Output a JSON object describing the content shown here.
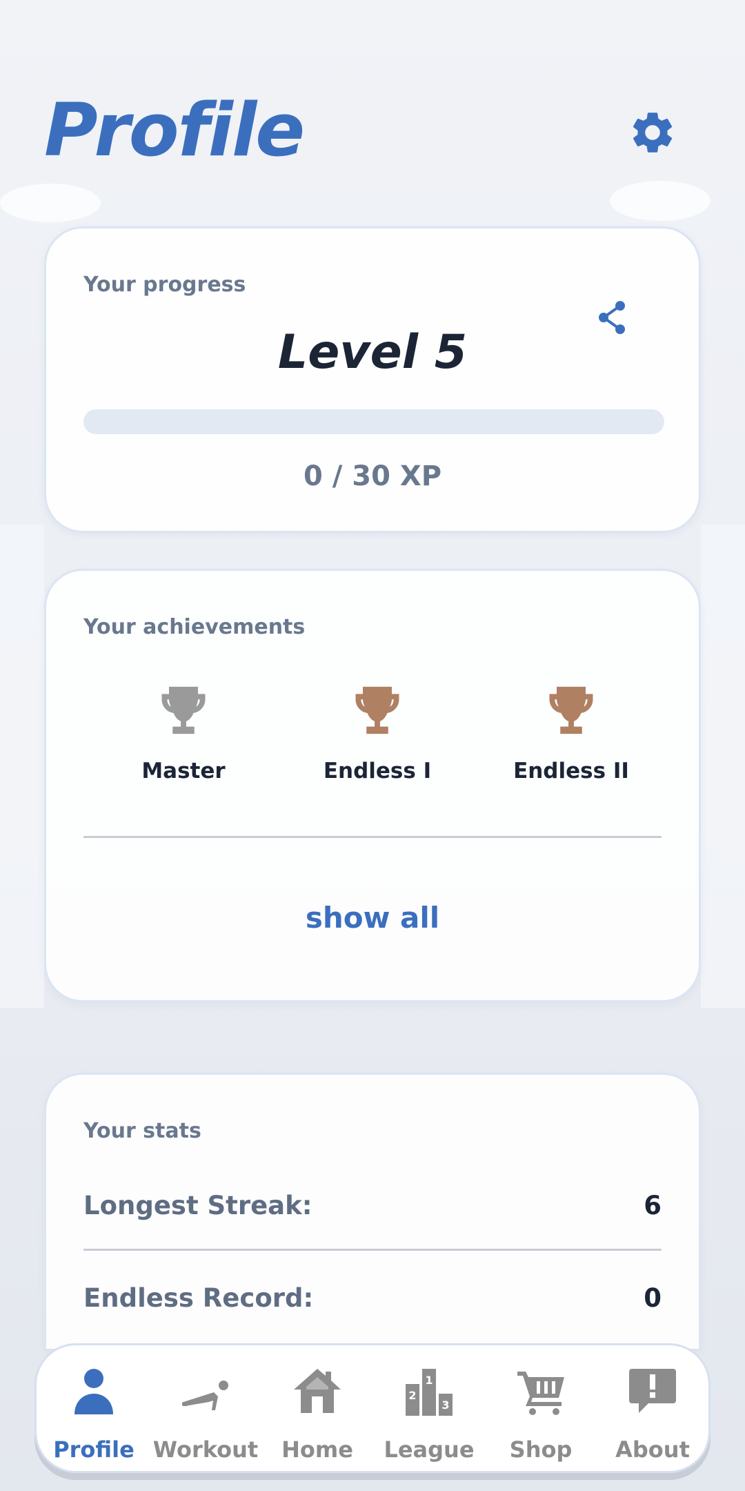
{
  "header": {
    "title": "Profile",
    "settings_icon": "gear-icon"
  },
  "progress": {
    "label": "Your progress",
    "level": "Level 5",
    "xp_text": "0 / 30 XP",
    "xp_fraction": 0,
    "share_icon": "share-icon"
  },
  "achievements": {
    "label": "Your achievements",
    "items": [
      {
        "name": "Master",
        "icon": "trophy-icon",
        "color": "#9a9a9a"
      },
      {
        "name": "Endless I",
        "icon": "trophy-icon",
        "color": "#b08063"
      },
      {
        "name": "Endless II",
        "icon": "trophy-icon",
        "color": "#b08063"
      }
    ],
    "show_all": "show all"
  },
  "stats": {
    "label": "Your stats",
    "rows": [
      {
        "label": "Longest Streak:",
        "value": "6"
      },
      {
        "label": "Endless Record:",
        "value": "0"
      }
    ]
  },
  "nav": {
    "items": [
      {
        "label": "Profile",
        "icon": "person-icon",
        "active": true
      },
      {
        "label": "Workout",
        "icon": "pushup-icon",
        "active": false
      },
      {
        "label": "Home",
        "icon": "home-icon",
        "active": false
      },
      {
        "label": "League",
        "icon": "podium-icon",
        "active": false
      },
      {
        "label": "Shop",
        "icon": "cart-icon",
        "active": false
      },
      {
        "label": "About",
        "icon": "info-bubble-icon",
        "active": false
      }
    ]
  },
  "colors": {
    "accent": "#3b6fbe",
    "text_dark": "#1c2536",
    "text_muted": "#6a788e",
    "nav_inactive": "#8c8c8c"
  }
}
